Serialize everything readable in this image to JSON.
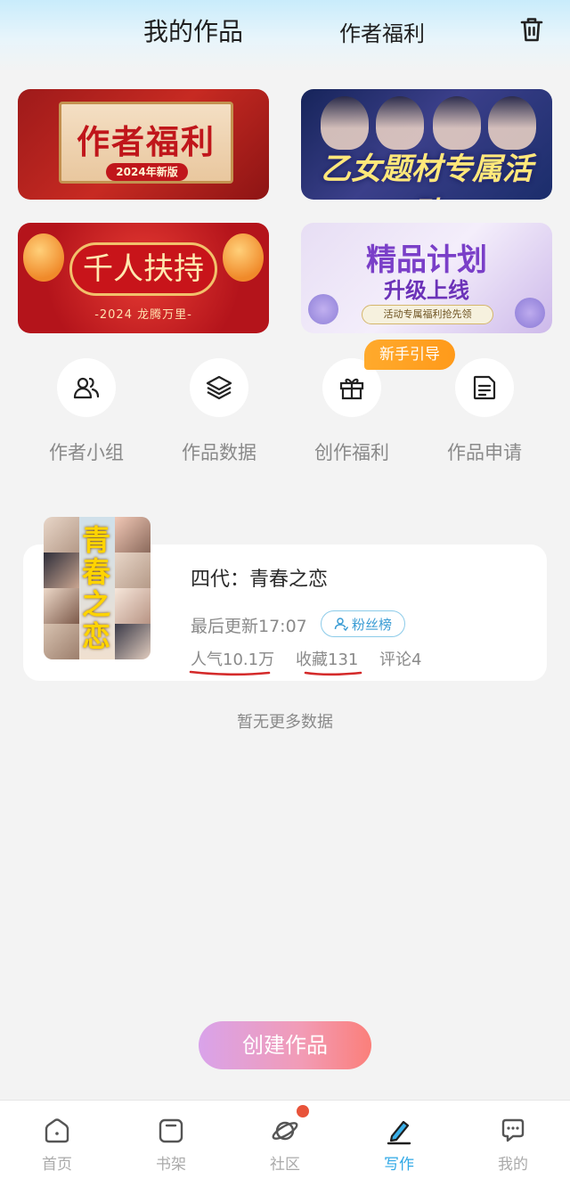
{
  "header": {
    "tab_works": "我的作品",
    "tab_benefits": "作者福利",
    "trash_icon": "trash-icon"
  },
  "banners": [
    {
      "title": "作者福利",
      "subtitle": "2024年新版"
    },
    {
      "title": "乙女题材专属活动"
    },
    {
      "title": "千人扶持",
      "subtitle": "-2024 龙腾万里-"
    },
    {
      "title": "精品计划",
      "title2": "升级上线",
      "subtitle": "活动专属福利抢先领"
    }
  ],
  "newbie_badge": "新手引导",
  "quick_actions": [
    {
      "label": "作者小组",
      "icon": "author-group-icon"
    },
    {
      "label": "作品数据",
      "icon": "layers-icon"
    },
    {
      "label": "创作福利",
      "icon": "gift-icon"
    },
    {
      "label": "作品申请",
      "icon": "document-icon"
    }
  ],
  "work": {
    "title": "四代：青春之恋",
    "cover_text": "青春之恋",
    "updated": "最后更新17:07",
    "fans_label": "粉丝榜",
    "popularity": "人气10.1万",
    "favorites": "收藏131",
    "comments": "评论4"
  },
  "no_more": "暂无更多数据",
  "create_button": "创建作品",
  "tabbar": [
    {
      "label": "首页",
      "icon": "home-icon"
    },
    {
      "label": "书架",
      "icon": "bookshelf-icon"
    },
    {
      "label": "社区",
      "icon": "planet-icon"
    },
    {
      "label": "写作",
      "icon": "pen-icon",
      "active": true
    },
    {
      "label": "我的",
      "icon": "chat-icon"
    }
  ],
  "colors": {
    "accent": "#2fa8e6",
    "badge": "#ff9a1a",
    "notification_dot": "#e8533a",
    "underline": "#d42a2a"
  }
}
